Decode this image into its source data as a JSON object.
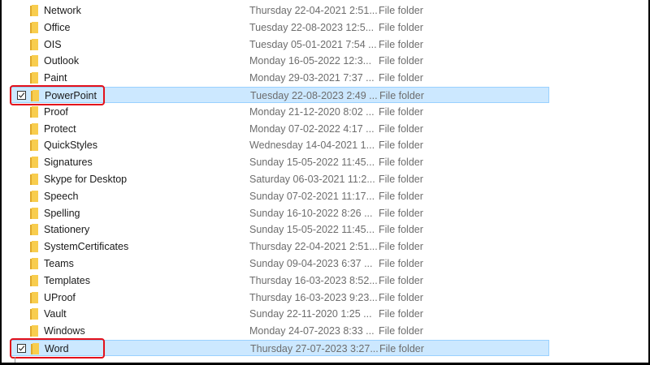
{
  "rows": [
    {
      "name": "Network",
      "date": "Thursday 22-04-2021 2:51...",
      "type": "File folder",
      "selected": false
    },
    {
      "name": "Office",
      "date": "Tuesday 22-08-2023 12:5...",
      "type": "File folder",
      "selected": false
    },
    {
      "name": "OIS",
      "date": "Tuesday 05-01-2021 7:54 ...",
      "type": "File folder",
      "selected": false
    },
    {
      "name": "Outlook",
      "date": "Monday 16-05-2022 12:3...",
      "type": "File folder",
      "selected": false
    },
    {
      "name": "Paint",
      "date": "Monday 29-03-2021 7:37 ...",
      "type": "File folder",
      "selected": false
    },
    {
      "name": "PowerPoint",
      "date": "Tuesday 22-08-2023 2:49 ...",
      "type": "File folder",
      "selected": true
    },
    {
      "name": "Proof",
      "date": "Monday 21-12-2020 8:02 ...",
      "type": "File folder",
      "selected": false
    },
    {
      "name": "Protect",
      "date": "Monday 07-02-2022 4:17 ...",
      "type": "File folder",
      "selected": false
    },
    {
      "name": "QuickStyles",
      "date": "Wednesday 14-04-2021 1...",
      "type": "File folder",
      "selected": false
    },
    {
      "name": "Signatures",
      "date": "Sunday 15-05-2022 11:45...",
      "type": "File folder",
      "selected": false
    },
    {
      "name": "Skype for Desktop",
      "date": "Saturday 06-03-2021 11:2...",
      "type": "File folder",
      "selected": false
    },
    {
      "name": "Speech",
      "date": "Sunday 07-02-2021 11:17...",
      "type": "File folder",
      "selected": false
    },
    {
      "name": "Spelling",
      "date": "Sunday 16-10-2022 8:26 ...",
      "type": "File folder",
      "selected": false
    },
    {
      "name": "Stationery",
      "date": "Sunday 15-05-2022 11:45...",
      "type": "File folder",
      "selected": false
    },
    {
      "name": "SystemCertificates",
      "date": "Thursday 22-04-2021 2:51...",
      "type": "File folder",
      "selected": false
    },
    {
      "name": "Teams",
      "date": "Sunday 09-04-2023 6:37 ...",
      "type": "File folder",
      "selected": false
    },
    {
      "name": "Templates",
      "date": "Thursday 16-03-2023 8:52...",
      "type": "File folder",
      "selected": false
    },
    {
      "name": "UProof",
      "date": "Thursday 16-03-2023 9:23...",
      "type": "File folder",
      "selected": false
    },
    {
      "name": "Vault",
      "date": "Sunday 22-11-2020 1:25 ...",
      "type": "File folder",
      "selected": false
    },
    {
      "name": "Windows",
      "date": "Monday 24-07-2023 8:33 ...",
      "type": "File folder",
      "selected": false
    },
    {
      "name": "Word",
      "date": "Thursday 27-07-2023 3:27...",
      "type": "File folder",
      "selected": true
    }
  ],
  "colors": {
    "highlight": "#e3101b",
    "selection": "#cce8ff",
    "folder": "#f8cd4e"
  },
  "icons": {
    "folder": "folder-icon",
    "check": "checkbox-checked-icon"
  }
}
